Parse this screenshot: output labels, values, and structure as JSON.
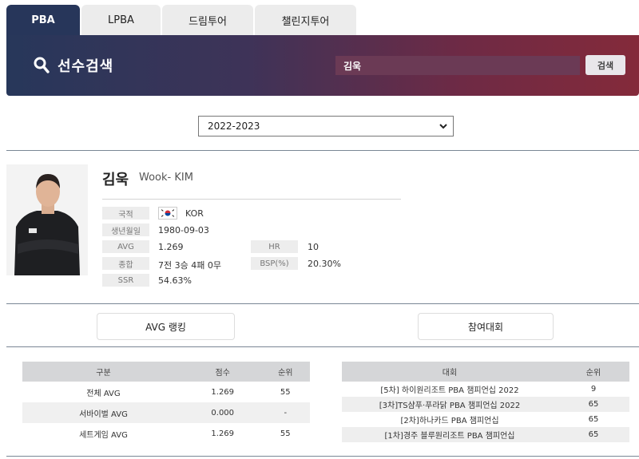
{
  "tabs": [
    "PBA",
    "LPBA",
    "드림투어",
    "챌린지투어"
  ],
  "banner": {
    "title": "선수검색",
    "search_value": "김욱",
    "search_button": "검색"
  },
  "season": {
    "selected": "2022-2023"
  },
  "player": {
    "name": "김욱",
    "name_en": "Wook- KIM",
    "fields": {
      "nationality_label": "국적",
      "nationality": "KOR",
      "birth_label": "생년월일",
      "birth": "1980-09-03",
      "avg_label": "AVG",
      "avg": "1.269",
      "hr_label": "HR",
      "hr": "10",
      "total_label": "종합",
      "total": "7전 3승 4패 0무",
      "bsp_label": "BSP(%)",
      "bsp": "20.30%",
      "ssr_label": "SSR",
      "ssr": "54.63%"
    }
  },
  "sections": {
    "ranking": "AVG 랭킹",
    "events": "참여대회"
  },
  "ranking_table": {
    "headers": [
      "구분",
      "점수",
      "순위"
    ],
    "rows": [
      [
        "전체 AVG",
        "1.269",
        "55"
      ],
      [
        "서바이벌 AVG",
        "0.000",
        "-"
      ],
      [
        "세트게임 AVG",
        "1.269",
        "55"
      ]
    ]
  },
  "events_table": {
    "headers": [
      "대회",
      "순위"
    ],
    "rows": [
      [
        "[5차] 하이원리조트 PBA 챔피언십 2022",
        "9"
      ],
      [
        "[3차]TS샴푸·푸라닭 PBA 챔피언십 2022",
        "65"
      ],
      [
        "[2차]하나카드 PBA 챔피언십",
        "65"
      ],
      [
        "[1차]경주 블루원리조트 PBA 챔피언십",
        "65"
      ]
    ]
  },
  "colors": {
    "navy": "#27365a",
    "maroon": "#842a3a"
  }
}
